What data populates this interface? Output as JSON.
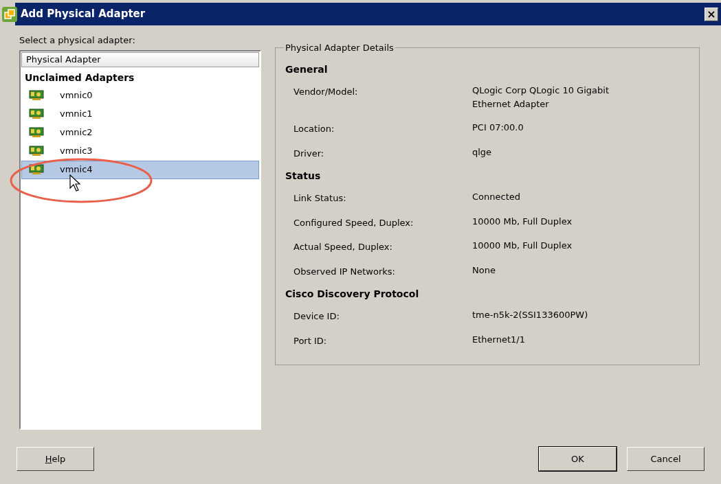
{
  "window": {
    "title": "Add Physical Adapter",
    "close": "×"
  },
  "prompt": "Select a physical adapter:",
  "adapter_list": {
    "column_header": "Physical Adapter",
    "group": "Unclaimed Adapters",
    "items": [
      {
        "label": "vmnic0",
        "selected": false
      },
      {
        "label": "vmnic1",
        "selected": false
      },
      {
        "label": "vmnic2",
        "selected": false
      },
      {
        "label": "vmnic3",
        "selected": false
      },
      {
        "label": "vmnic4",
        "selected": true
      }
    ]
  },
  "details": {
    "title": "Physical Adapter Details",
    "sections": [
      {
        "title": "General",
        "rows": [
          {
            "label": "Vendor/Model:",
            "value": "QLogic Corp QLogic 10 Gigabit Ethernet Adapter"
          },
          {
            "label": "Location:",
            "value": "PCI 07:00.0"
          },
          {
            "label": "Driver:",
            "value": "qlge"
          }
        ]
      },
      {
        "title": "Status",
        "rows": [
          {
            "label": "Link Status:",
            "value": "Connected"
          },
          {
            "label": "Configured Speed, Duplex:",
            "value": "10000 Mb, Full Duplex"
          },
          {
            "label": "Actual Speed, Duplex:",
            "value": "10000 Mb, Full Duplex"
          },
          {
            "label": "Observed IP Networks:",
            "value": "None"
          }
        ]
      },
      {
        "title": "Cisco Discovery Protocol",
        "rows": [
          {
            "label": "Device ID:",
            "value": "tme-n5k-2(SSI133600PW)"
          },
          {
            "label": "Port ID:",
            "value": "Ethernet1/1"
          }
        ]
      }
    ]
  },
  "buttons": [
    {
      "label": "Help",
      "kind": "left"
    },
    {
      "label": "OK",
      "kind": "default"
    },
    {
      "label": "Cancel",
      "kind": "normal"
    }
  ]
}
